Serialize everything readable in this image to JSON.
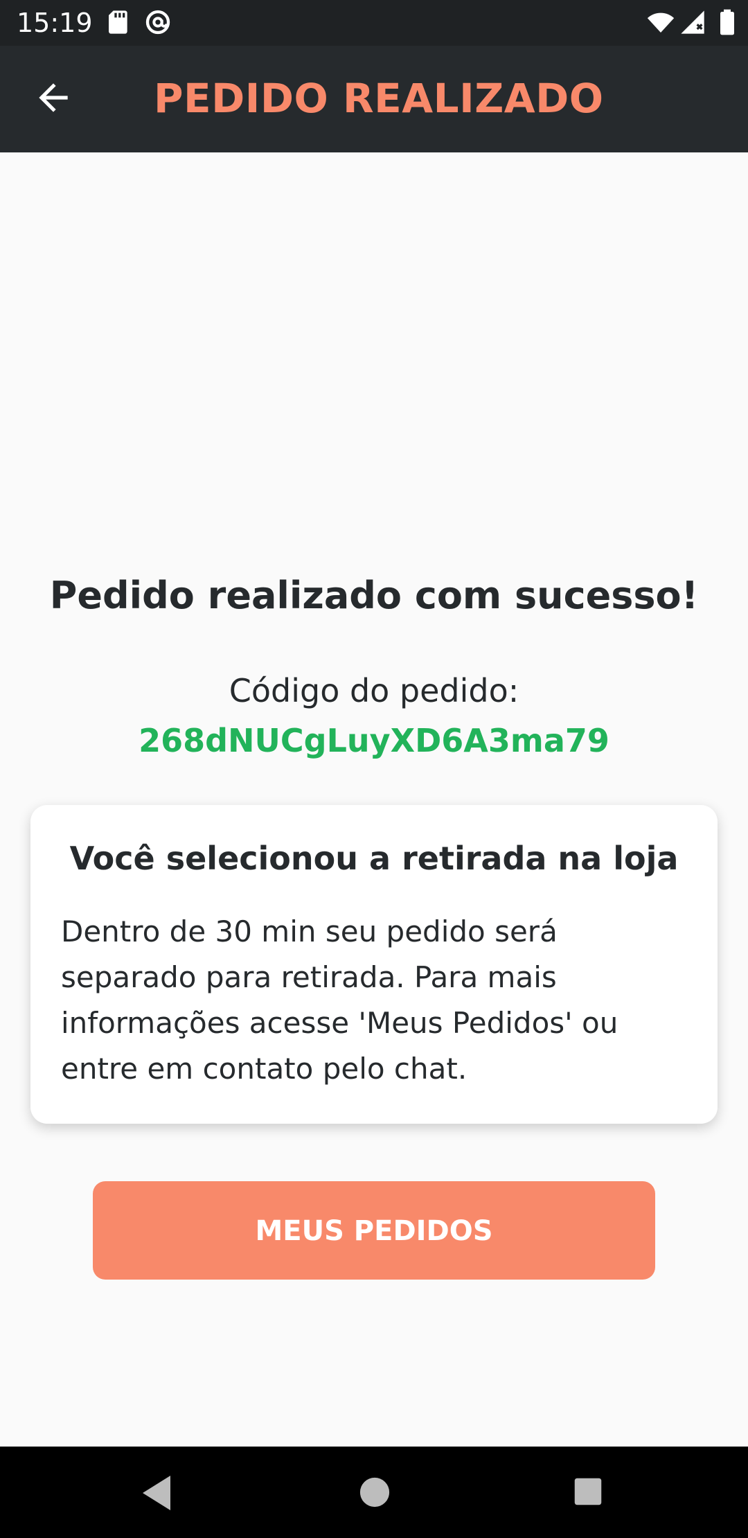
{
  "status_bar": {
    "time": "15:19",
    "icons": [
      "sd-card-icon",
      "at-sign-icon",
      "wifi-icon",
      "signal-icon",
      "battery-icon"
    ]
  },
  "app_bar": {
    "title": "PEDIDO REALIZADO",
    "back_icon": "arrow-left-icon",
    "background_color": "#262a2d",
    "title_color": "#f8896a"
  },
  "content": {
    "success_title": "Pedido realizado com sucesso!",
    "order_label": "Código do pedido:",
    "order_code": "268dNUCgLuyXD6A3ma79",
    "order_code_color": "#22b35a"
  },
  "card": {
    "title": "Você selecionou a retirada na loja",
    "body": "Dentro de 30 min seu pedido será separado para retirada. Para mais informações acesse 'Meus Pedidos' ou entre em contato pelo chat."
  },
  "button": {
    "label": "MEUS PEDIDOS",
    "color": "#f8896a"
  },
  "nav_bar": {
    "icons": [
      "nav-back-icon",
      "nav-home-icon",
      "nav-recents-icon"
    ]
  }
}
